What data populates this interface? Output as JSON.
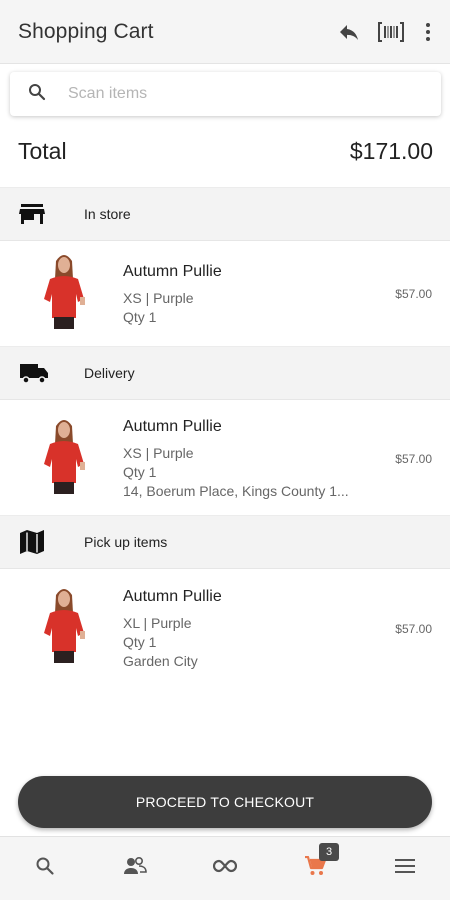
{
  "header": {
    "title": "Shopping Cart",
    "actions": [
      "reply-icon",
      "barcode-icon",
      "more-vertical-icon"
    ]
  },
  "search": {
    "placeholder": "Scan items",
    "value": ""
  },
  "total": {
    "label": "Total",
    "amount": "$171.00"
  },
  "sections": [
    {
      "label": "In store",
      "icon": "store-icon",
      "items": [
        {
          "name": "Autumn Pullie",
          "details": [
            "XS | Purple",
            "Qty 1"
          ],
          "price": "$57.00"
        }
      ]
    },
    {
      "label": "Delivery",
      "icon": "truck-icon",
      "items": [
        {
          "name": "Autumn Pullie",
          "details": [
            "XS | Purple",
            "Qty 1",
            "14, Boerum Place, Kings County 1..."
          ],
          "price": "$57.00"
        }
      ]
    },
    {
      "label": "Pick up items",
      "icon": "map-icon",
      "items": [
        {
          "name": "Autumn Pullie",
          "details": [
            "XL | Purple",
            "Qty 1",
            "Garden City"
          ],
          "price": "$57.00"
        }
      ]
    }
  ],
  "checkout": {
    "label": "PROCEED TO CHECKOUT"
  },
  "bottom_nav": {
    "items": [
      "search-icon",
      "people-icon",
      "infinity-icon",
      "cart-icon",
      "menu-icon"
    ],
    "cart_badge": "3",
    "active": "cart-icon"
  },
  "colors": {
    "accent": "#e9774b",
    "checkout_bg": "#3d3d3d",
    "section_bg": "#f3f3f3"
  }
}
